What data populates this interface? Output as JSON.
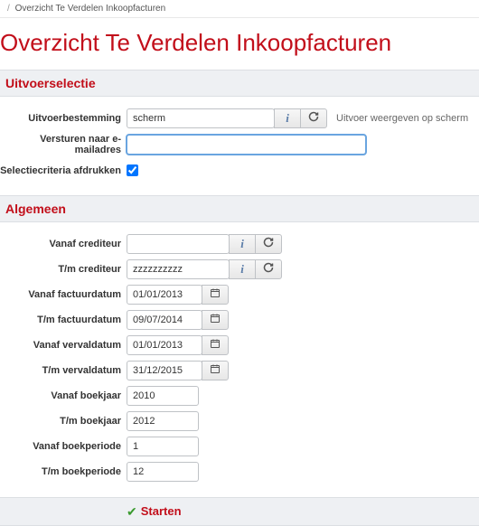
{
  "breadcrumb": {
    "item": "Overzicht Te Verdelen Inkoopfacturen"
  },
  "pageTitle": "Overzicht Te Verdelen Inkoopfacturen",
  "sections": {
    "output": "Uitvoerselectie",
    "general": "Algemeen"
  },
  "output": {
    "destLabel": "Uitvoerbestemming",
    "destValue": "scherm",
    "destHint": "Uitvoer weergeven op scherm",
    "emailLabel": "Versturen naar e-mailadres",
    "emailValue": "",
    "printCriteriaLabel": "Selectiecriteria afdrukken",
    "printCriteriaChecked": true
  },
  "general": {
    "fromCreditorLabel": "Vanaf crediteur",
    "fromCreditorValue": "",
    "toCreditorLabel": "T/m crediteur",
    "toCreditorValue": "zzzzzzzzzz",
    "fromInvoiceDateLabel": "Vanaf factuurdatum",
    "fromInvoiceDateValue": "01/01/2013",
    "toInvoiceDateLabel": "T/m factuurdatum",
    "toInvoiceDateValue": "09/07/2014",
    "fromDueDateLabel": "Vanaf vervaldatum",
    "fromDueDateValue": "01/01/2013",
    "toDueDateLabel": "T/m vervaldatum",
    "toDueDateValue": "31/12/2015",
    "fromYearLabel": "Vanaf boekjaar",
    "fromYearValue": "2010",
    "toYearLabel": "T/m boekjaar",
    "toYearValue": "2012",
    "fromPeriodLabel": "Vanaf boekperiode",
    "fromPeriodValue": "1",
    "toPeriodLabel": "T/m boekperiode",
    "toPeriodValue": "12"
  },
  "footer": {
    "startLabel": "Starten"
  }
}
